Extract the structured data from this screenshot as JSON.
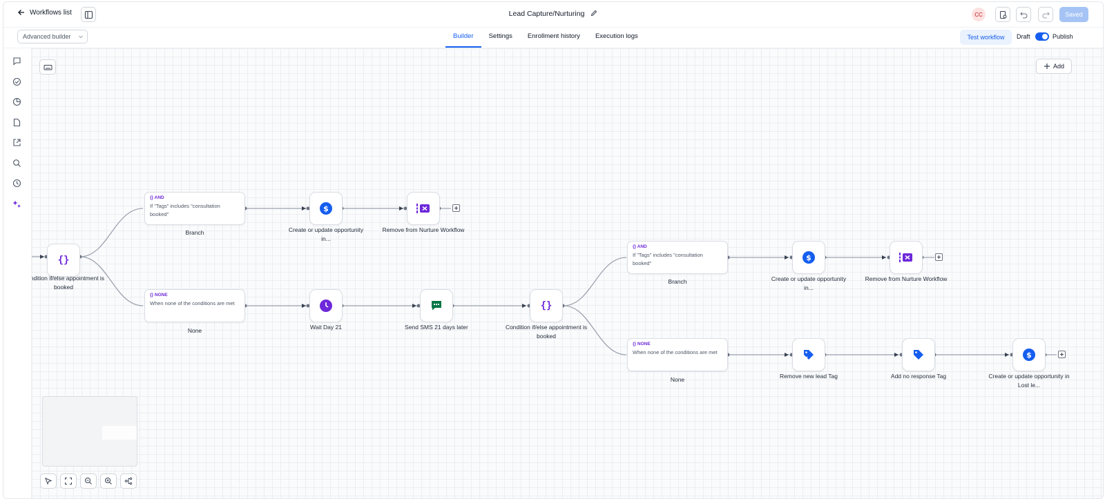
{
  "topbar": {
    "back_label": "Workflows list",
    "workflow_title": "Lead Capture/Nurturing",
    "avatar_initials": "CC",
    "saved_label": "Saved"
  },
  "subbar": {
    "builder_mode": "Advanced builder",
    "tabs": [
      {
        "label": "Builder",
        "active": true
      },
      {
        "label": "Settings",
        "active": false
      },
      {
        "label": "Enrollment history",
        "active": false
      },
      {
        "label": "Execution logs",
        "active": false
      }
    ],
    "test_label": "Test workflow",
    "draft_label": "Draft",
    "publish_label": "Publish",
    "published": true
  },
  "canvas": {
    "add_label": "Add",
    "nodes": {
      "cond1": "Condition if/else appointment is booked",
      "branch_and_1": {
        "tag": "AND",
        "condition": "If \"Tags\" includes \"consultation booked\"",
        "label": "Branch"
      },
      "branch_none_1": {
        "tag": "NONE",
        "condition": "When none of the conditions are met",
        "label": "None"
      },
      "opp1": "Create or update opportunity in...",
      "remove1": "Remove from Nurture Workflow",
      "wait": "Wait Day 21",
      "sms": "Send SMS 21 days later",
      "cond2": "Condition if/else appointment is booked",
      "branch_and_2": {
        "tag": "AND",
        "condition": "If \"Tags\" includes \"consultation booked\"",
        "label": "Branch"
      },
      "branch_none_2": {
        "tag": "NONE",
        "condition": "When none of the conditions are met",
        "label": "None"
      },
      "opp2": "Create or update opportunity in...",
      "remove2": "Remove from Nurture Workflow",
      "remove_tag": "Remove new lead Tag",
      "add_tag": "Add no response Tag",
      "opp3": "Create or update opportunity in Lost le..."
    }
  },
  "colors": {
    "primary": "#155eef",
    "purple": "#6d28d9",
    "green": "#067647",
    "saved_bg": "#a5c4f5"
  }
}
